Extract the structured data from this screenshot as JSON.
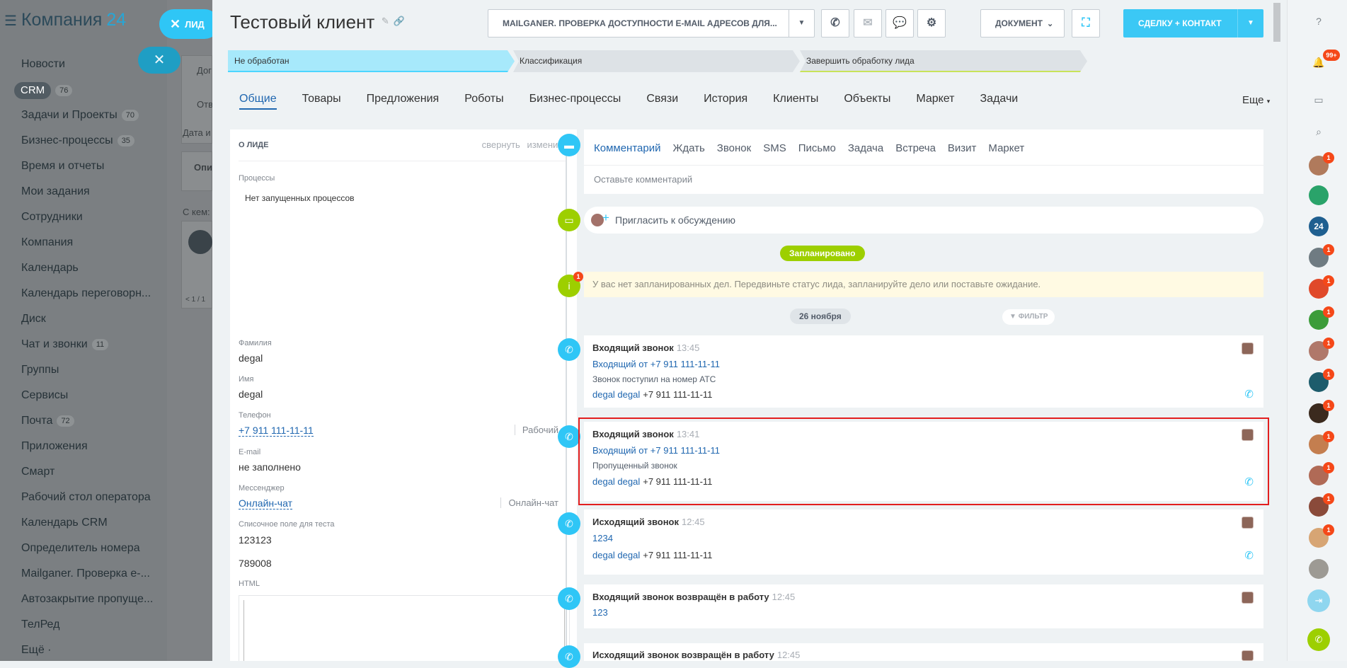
{
  "sidebar": {
    "logo_prefix": "Компания",
    "logo_suffix": "24",
    "items": [
      {
        "label": "Новости",
        "count": ""
      },
      {
        "label": "CRM",
        "count": "76"
      },
      {
        "label": "Задачи и Проекты",
        "count": "70"
      },
      {
        "label": "Бизнес-процессы",
        "count": "35"
      },
      {
        "label": "Время и отчеты",
        "count": ""
      },
      {
        "label": "Мои задания",
        "count": ""
      },
      {
        "label": "Сотрудники",
        "count": ""
      },
      {
        "label": "Компания",
        "count": ""
      },
      {
        "label": "Календарь",
        "count": ""
      },
      {
        "label": "Календарь переговорн...",
        "count": ""
      },
      {
        "label": "Диск",
        "count": ""
      },
      {
        "label": "Чат и звонки",
        "count": "11"
      },
      {
        "label": "Группы",
        "count": ""
      },
      {
        "label": "Сервисы",
        "count": ""
      },
      {
        "label": "Почта",
        "count": "72"
      },
      {
        "label": "Приложения",
        "count": ""
      },
      {
        "label": "Смарт",
        "count": ""
      },
      {
        "label": "Рабочий стол оператора",
        "count": ""
      },
      {
        "label": "Календарь CRM",
        "count": ""
      },
      {
        "label": "Определитель номера",
        "count": ""
      },
      {
        "label": "Mailganer. Проверка e-...",
        "count": ""
      },
      {
        "label": "Автозакрытие пропуще...",
        "count": ""
      },
      {
        "label": "ТелРед",
        "count": ""
      },
      {
        "label": "Ещё ·",
        "count": ""
      }
    ]
  },
  "underlay": {
    "t1": "Дог",
    "t2": "Отв",
    "t3": "Дата и",
    "t4": "Опи",
    "t5": "С кем:",
    "t6": "< 1 / 1"
  },
  "close_bubble": {
    "label": "ЛИД"
  },
  "header": {
    "title": "Тестовый  клиент",
    "mailganer_label": "MAILGANER. ПРОВЕРКА ДОСТУПНОСТИ E-MAIL АДРЕСОВ ДЛЯ...",
    "document_label": "ДОКУМЕНТ",
    "deal_label": "СДЕЛКУ + КОНТАКТ"
  },
  "stages": [
    "Не обработан",
    "Классификация",
    "Завершить обработку лида"
  ],
  "tabs": [
    "Общие",
    "Товары",
    "Предложения",
    "Роботы",
    "Бизнес-процессы",
    "Связи",
    "История",
    "Клиенты",
    "Объекты",
    "Маркет",
    "Задачи"
  ],
  "more_tab": "Еще",
  "info": {
    "heading": "О ЛИДЕ",
    "collapse": "свернуть",
    "edit": "изменить",
    "processes_label": "Процессы",
    "processes_value": "Нет запущенных процессов",
    "lastname_label": "Фамилия",
    "lastname_value": "degal",
    "name_label": "Имя",
    "name_value": "degal",
    "phone_label": "Телефон",
    "phone_value": "+7 911 111-11-11",
    "phone_type": "Рабочий",
    "email_label": "E-mail",
    "email_value": "не заполнено",
    "messenger_label": "Мессенджер",
    "messenger_value": "Онлайн-чат",
    "messenger_type": "Онлайн-чат",
    "list_label": "Списочное поле для теста",
    "list_value1": "123123",
    "list_value2": "789008",
    "html_label": "HTML"
  },
  "editor": {
    "tabs": [
      "Комментарий",
      "Ждать",
      "Звонок",
      "SMS",
      "Письмо",
      "Задача",
      "Встреча",
      "Визит",
      "Маркет"
    ],
    "placeholder": "Оставьте комментарий"
  },
  "invite": "Пригласить к обсуждению",
  "planned": "Запланировано",
  "notice": "У вас нет запланированных дел. Передвиньте статус лида, запланируйте дело или поставьте ожидание.",
  "notice_badge": "1",
  "date": "26 ноября",
  "filter": "ФИЛЬТР",
  "events": [
    {
      "title": "Входящий звонок",
      "time": "13:45",
      "l1": "Входящий от +7 911 111-11-11",
      "l2": "Звонок поступил на номер АТС",
      "name": "degal degal",
      "phone": "+7 911 111-11-11"
    },
    {
      "title": "Входящий звонок",
      "time": "13:41",
      "l1": "Входящий от +7 911 111-11-11",
      "l2": "Пропущенный звонок",
      "name": "degal degal",
      "phone": "+7 911 111-11-11"
    },
    {
      "title": "Исходящий звонок",
      "time": "12:45",
      "l1": "1234",
      "name": "degal degal",
      "phone": "+7 911 111-11-11"
    },
    {
      "title": "Входящий звонок возвращён в работу",
      "time": "12:45",
      "l1": "123"
    },
    {
      "title": "Исходящий звонок возвращён в работу",
      "time": "12:45"
    }
  ],
  "right_bar": {
    "notif_count": "99+",
    "badge": "1",
    "logo": "24"
  },
  "colors": {
    "accent": "#2fc6f6",
    "link": "#2067b0",
    "green": "#9dcf00",
    "badge": "#f54819",
    "highlight": "#e21e1e"
  }
}
